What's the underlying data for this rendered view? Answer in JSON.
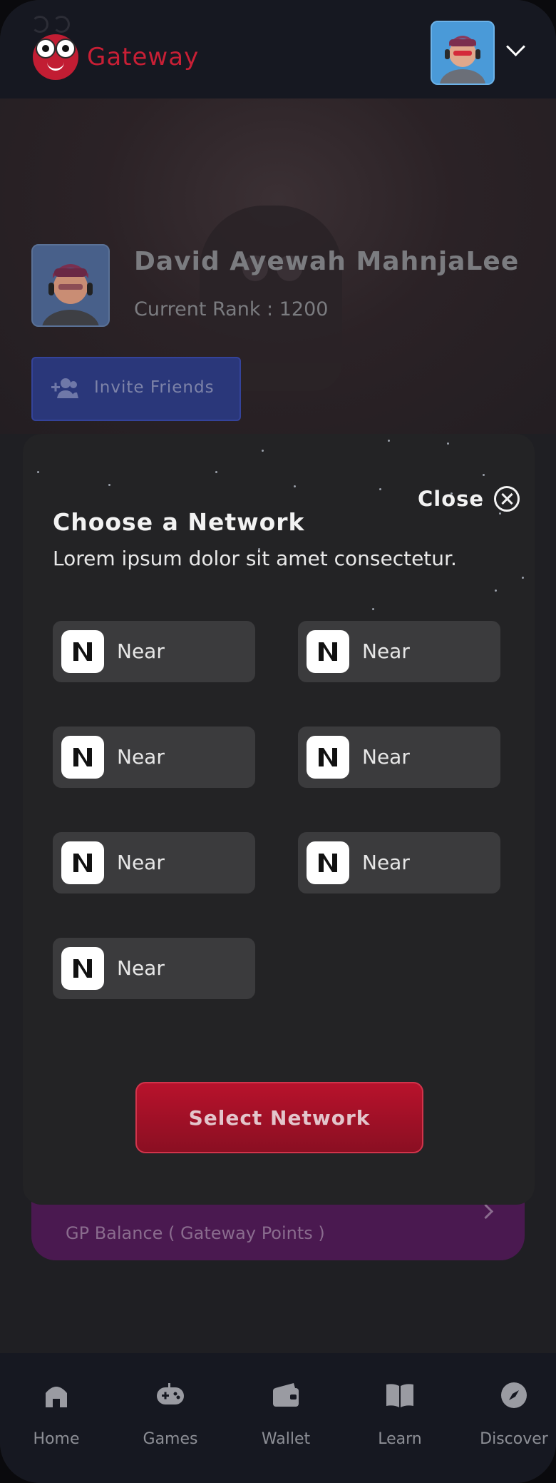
{
  "header": {
    "app_name": "Gateway",
    "logo_icon": "ladybug-mascot-icon",
    "profile_menu_icon": "chevron-down-icon"
  },
  "profile": {
    "name": "David Ayewah MahnjaLee",
    "rank": "Current Rank : 1200",
    "invite_label": "Invite Friends",
    "invite_icon": "add-user-icon"
  },
  "points_card": {
    "label": "GP Balance ( Gateway Points )",
    "chevron_icon": "chevron-right-icon"
  },
  "modal": {
    "close_label": "Close",
    "close_icon": "close-circle-icon",
    "title": "Choose a Network",
    "subtitle": "Lorem ipsum dolor sit amet consectetur.",
    "networks": [
      {
        "label": "Near",
        "icon": "near-logo-icon"
      },
      {
        "label": "Near",
        "icon": "near-logo-icon"
      },
      {
        "label": "Near",
        "icon": "near-logo-icon"
      },
      {
        "label": "Near",
        "icon": "near-logo-icon"
      },
      {
        "label": "Near",
        "icon": "near-logo-icon"
      },
      {
        "label": "Near",
        "icon": "near-logo-icon"
      },
      {
        "label": "Near",
        "icon": "near-logo-icon"
      }
    ],
    "select_label": "Select Network"
  },
  "bottom_nav": {
    "items": [
      {
        "label": "Home",
        "icon": "home-icon"
      },
      {
        "label": "Games",
        "icon": "gamepad-icon"
      },
      {
        "label": "Wallet",
        "icon": "wallet-icon"
      },
      {
        "label": "Learn",
        "icon": "book-open-icon"
      },
      {
        "label": "Discover",
        "icon": "compass-icon"
      }
    ]
  },
  "colors": {
    "brand_red": "#c81f35",
    "modal_bg": "#232325",
    "invite_blue": "#2a377a",
    "points_purple": "#4a1950"
  }
}
